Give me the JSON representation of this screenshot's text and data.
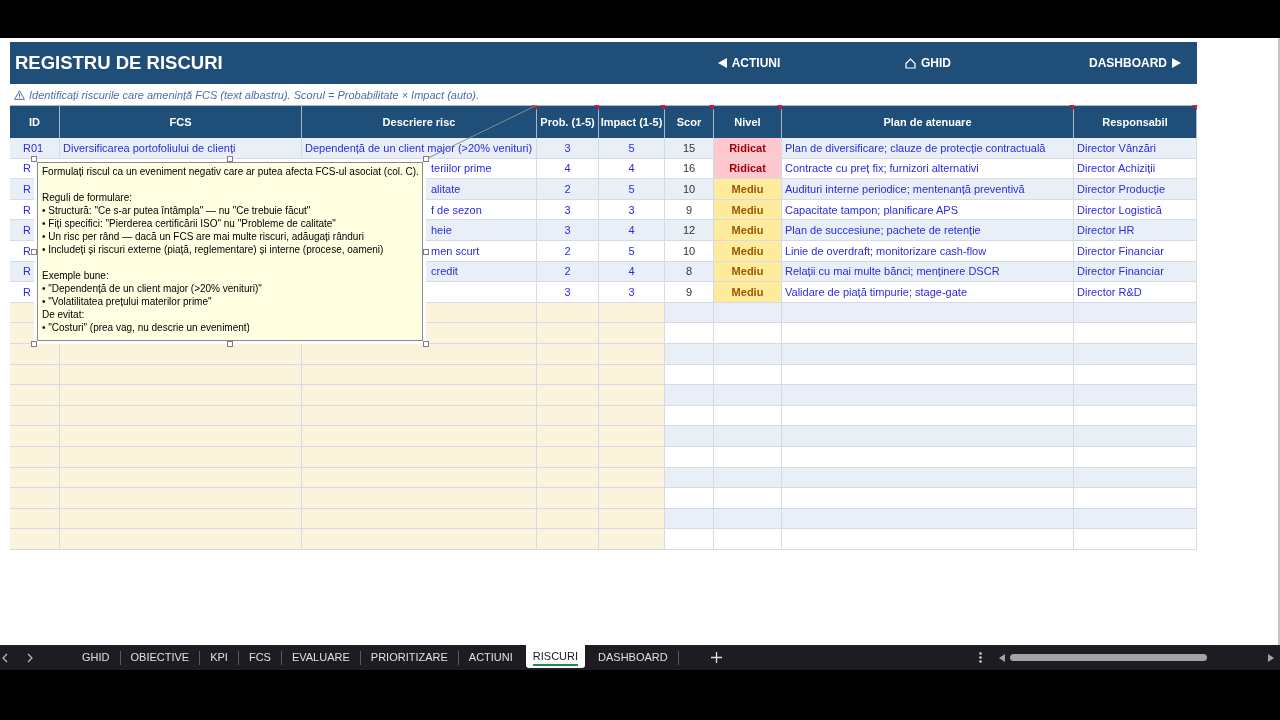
{
  "header": {
    "title": "REGISTRU DE RISCURI",
    "nav_buttons": [
      {
        "label": "ACTIUNI",
        "kind": "back"
      },
      {
        "label": "GHID",
        "kind": "home"
      },
      {
        "label": "DASHBOARD",
        "kind": "forward"
      }
    ]
  },
  "instruction": "Identificați riscurile care amenință FCS (text albastru). Scorul = Probabilitate × Impact (auto).",
  "table": {
    "columns": [
      {
        "label": "ID",
        "kind": "input-text",
        "has_comment": false
      },
      {
        "label": "FCS",
        "kind": "input-text",
        "has_comment": false
      },
      {
        "label": "Descriere risc",
        "kind": "input-text",
        "has_comment": true
      },
      {
        "label": "Prob. (1-5)",
        "kind": "input-number",
        "has_comment": true
      },
      {
        "label": "Impact (1-5)",
        "kind": "input-number",
        "has_comment": true
      },
      {
        "label": "Scor",
        "kind": "score",
        "has_comment": true
      },
      {
        "label": "Nivel",
        "kind": "level",
        "has_comment": true
      },
      {
        "label": "Plan de atenuare",
        "kind": "text",
        "has_comment": true
      },
      {
        "label": "Responsabil",
        "kind": "text",
        "has_comment": true
      }
    ],
    "rows": [
      {
        "id": "R01",
        "fcs": "Diversificarea portofoliului de clienți",
        "description": "Dependență de un client major (>20% venituri)",
        "probability": "3",
        "impact": "5",
        "score": "15",
        "nivel": {
          "label": "Ridicat",
          "kind": "high"
        },
        "plan": "Plan de diversificare; clauze de protecție contractuală",
        "owner": "Director Vânzări"
      },
      {
        "id": "R",
        "description": "teriilor prime",
        "probability": "4",
        "impact": "4",
        "score": "16",
        "nivel": {
          "label": "Ridicat",
          "kind": "high"
        },
        "plan": "Contracte cu preț fix; furnizori alternativi",
        "owner": "Director Achiziții"
      },
      {
        "id": "R",
        "description": "alitate",
        "probability": "2",
        "impact": "5",
        "score": "10",
        "nivel": {
          "label": "Mediu",
          "kind": "medium"
        },
        "plan": "Audituri interne periodice; mentenanță preventivă",
        "owner": "Director Producție"
      },
      {
        "id": "R",
        "description": "f de sezon",
        "probability": "3",
        "impact": "3",
        "score": "9",
        "nivel": {
          "label": "Mediu",
          "kind": "medium"
        },
        "plan": "Capacitate tampon; planificare APS",
        "owner": "Director Logistică"
      },
      {
        "id": "R",
        "description": "heie",
        "probability": "3",
        "impact": "4",
        "score": "12",
        "nivel": {
          "label": "Mediu",
          "kind": "medium"
        },
        "plan": "Plan de succesiune; pachete de retenție",
        "owner": "Director HR"
      },
      {
        "id": "R",
        "description": "men scurt",
        "probability": "2",
        "impact": "5",
        "score": "10",
        "nivel": {
          "label": "Mediu",
          "kind": "medium"
        },
        "plan": "Linie de overdraft; monitorizare cash-flow",
        "owner": "Director Financiar"
      },
      {
        "id": "R",
        "description": "credit",
        "probability": "2",
        "impact": "4",
        "score": "8",
        "nivel": {
          "label": "Mediu",
          "kind": "medium"
        },
        "plan": "Relații cu mai multe bănci; menținere DSCR",
        "owner": "Director Financiar"
      },
      {
        "id": "R",
        "probability": "3",
        "impact": "3",
        "score": "9",
        "nivel": {
          "label": "Mediu",
          "kind": "medium"
        },
        "plan": "Validare de piață timpurie; stage-gate",
        "owner": "Director R&D"
      }
    ]
  },
  "comment_note": {
    "blocks": [
      {
        "lines": [
          "Formulați riscul ca un eveniment negativ care ar putea afecta FCS-ul asociat (col. C)."
        ]
      },
      {
        "lines": [
          "Reguli de formulare:",
          "• Structură: \"Ce s-ar putea întâmpla\" — nu \"Ce trebuie făcut\"",
          "• Fiți specifici: \"Pierderea certificării ISO\" nu \"Probleme de calitate\"",
          "• Un risc per rând — dacă un FCS are mai multe riscuri, adăugați rânduri",
          "• Includeți și riscuri externe (piață, reglementare) și interne (procese, oameni)"
        ]
      },
      {
        "lines": [
          "Exemple bune:",
          "• \"Dependență de un client major (>20% venituri)\"",
          "• \"Volatilitatea prețului materilor prime\"",
          "De evitat:",
          "• \"Costuri\" (prea vag, nu descrie un eveniment)"
        ]
      }
    ]
  },
  "sheet_tabs": [
    {
      "label": "GHID",
      "selected": false
    },
    {
      "label": "OBIECTIVE",
      "selected": false
    },
    {
      "label": "KPI",
      "selected": false
    },
    {
      "label": "FCS",
      "selected": false
    },
    {
      "label": "EVALUARE",
      "selected": false
    },
    {
      "label": "PRIORITIZARE",
      "selected": false
    },
    {
      "label": "ACTIUNI",
      "selected": false
    },
    {
      "label": "RISCURI",
      "selected": true
    },
    {
      "label": "DASHBOARD",
      "selected": false
    }
  ]
}
